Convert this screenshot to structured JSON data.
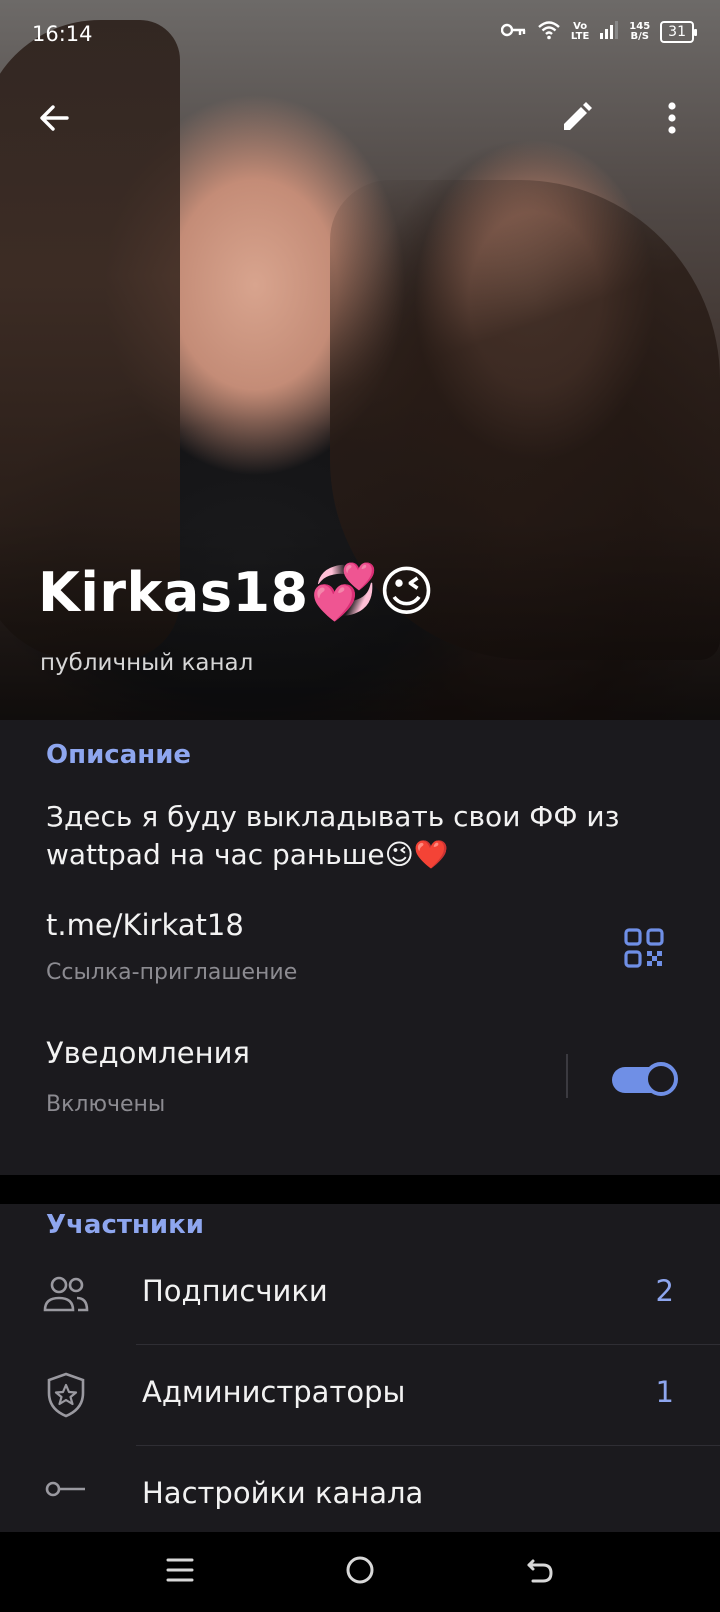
{
  "status": {
    "time": "16:14",
    "network_top": "Vo",
    "network_bottom": "LTE",
    "speed_top": "145",
    "speed_bottom": "B/S",
    "battery": "31"
  },
  "channel": {
    "name": "Kirkas18",
    "name_emojis": "💞😉",
    "subtitle": "публичный канал"
  },
  "info": {
    "description_heading": "Описание",
    "description": "Здесь я буду выкладывать свои ФФ из wattpad на час раньше😉❤️",
    "link": "t.me/Kirkat18",
    "link_label": "Ссылка-приглашение",
    "notifications": "Уведомления",
    "notifications_state": "Включены",
    "notifications_enabled": true
  },
  "members": {
    "heading": "Участники",
    "rows": [
      {
        "label": "Подписчики",
        "count": "2",
        "icon": "people-icon"
      },
      {
        "label": "Администраторы",
        "count": "1",
        "icon": "shield-star-icon"
      },
      {
        "label": "Настройки канала",
        "count": "",
        "icon": "key-icon"
      }
    ]
  },
  "colors": {
    "accent": "#8ea6ef",
    "card_bg": "#1b1a1e",
    "toggle_on": "#6f8fe6"
  }
}
